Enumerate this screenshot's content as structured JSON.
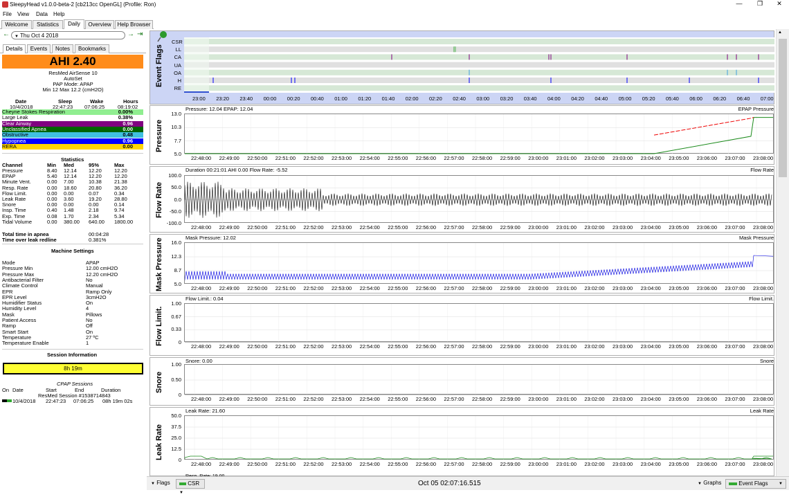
{
  "window": {
    "title": "SleepyHead v1.0.0-beta-2 [cb213cc OpenGL] (Profile: Ron)"
  },
  "menu": [
    "File",
    "View",
    "Data",
    "Help"
  ],
  "tabs": [
    {
      "label": "Welcome"
    },
    {
      "label": "Statistics"
    },
    {
      "label": "Daily",
      "active": true
    },
    {
      "label": "Overview"
    },
    {
      "label": "Help Browser"
    }
  ],
  "nav": {
    "date": "Thu Oct 4 2018"
  },
  "subtabs": [
    "Details",
    "Events",
    "Notes",
    "Bookmarks"
  ],
  "ahi": {
    "label": "AHI 2.40",
    "color": "#ff8c1a"
  },
  "machine": {
    "name": "ResMed AirSense 10",
    "model": "AutoSet",
    "mode": "PAP Mode: APAP",
    "pressure": "Min 12 Max 12.2 (cmH2O)"
  },
  "times": {
    "headers": [
      "Date",
      "Sleep",
      "Wake",
      "Hours"
    ],
    "values": [
      "10/4/2018",
      "22:47:23",
      "07:06:25",
      "08:19:02"
    ]
  },
  "events": [
    {
      "label": "Cheyne Stokes Respiration",
      "value": "0.00%",
      "bg": "#90ee90",
      "fg": "#000"
    },
    {
      "label": "Large Leak",
      "value": "0.38%",
      "bg": "#ffffff",
      "fg": "#000"
    },
    {
      "label": "Clear Airway",
      "value": "0.96",
      "bg": "#800080",
      "fg": "#fff"
    },
    {
      "label": "Unclassified Apnea",
      "value": "0.00",
      "bg": "#006400",
      "fg": "#fff"
    },
    {
      "label": "Obstructive",
      "value": "0.48",
      "bg": "#40c0e0",
      "fg": "#000"
    },
    {
      "label": "Hypopnea",
      "value": "0.96",
      "bg": "#0000ff",
      "fg": "#fff"
    },
    {
      "label": "RERA",
      "value": "0.00",
      "bg": "#ffd700",
      "fg": "#000"
    }
  ],
  "statistics": {
    "title": "Statistics",
    "headers": [
      "Channel",
      "Min",
      "Med",
      "95%",
      "Max"
    ],
    "rows": [
      [
        "Pressure",
        "8.40",
        "12.14",
        "12.20",
        "12.20"
      ],
      [
        "EPAP",
        "5.40",
        "12.14",
        "12.20",
        "12.20"
      ],
      [
        "Minute Vent.",
        "0.00",
        "7.00",
        "10.38",
        "21.38"
      ],
      [
        "Resp. Rate",
        "0.00",
        "18.60",
        "20.80",
        "36.20"
      ],
      [
        "Flow Limit.",
        "0.00",
        "0.00",
        "0.07",
        "0.34"
      ],
      [
        "Leak Rate",
        "0.00",
        "3.60",
        "19.20",
        "28.80"
      ],
      [
        "Snore",
        "0.00",
        "0.00",
        "0.00",
        "0.14"
      ],
      [
        "Insp. Time",
        "0.40",
        "1.48",
        "2.18",
        "9.74"
      ],
      [
        "Exp. Time",
        "0.08",
        "1.70",
        "2.34",
        "5.34"
      ],
      [
        "Tidal Volume",
        "0.00",
        "380.00",
        "640.00",
        "1800.00"
      ]
    ]
  },
  "totals": [
    {
      "label": "Total time in apnea",
      "value": "00:04:28"
    },
    {
      "label": "Time over leak redline",
      "value": "0.381%"
    }
  ],
  "machine_settings": {
    "title": "Machine Settings",
    "rows": [
      [
        "Mode",
        "APAP"
      ],
      [
        "Pressure Min",
        "12.00 cmH2O"
      ],
      [
        "Pressure Max",
        "12.20 cmH2O"
      ],
      [
        "Antibacterial Filter",
        "No"
      ],
      [
        "Climate Control",
        "Manual"
      ],
      [
        "EPR",
        "Ramp Only"
      ],
      [
        "EPR Level",
        "3cmH2O"
      ],
      [
        "Humidifier Status",
        "On"
      ],
      [
        "Humidity Level",
        "4"
      ],
      [
        "Mask",
        "Pillows"
      ],
      [
        "Patient Access",
        "No"
      ],
      [
        "Ramp",
        "Off"
      ],
      [
        "Smart Start",
        "On"
      ],
      [
        "Temperature",
        "27 ºC"
      ],
      [
        "Temperature Enable",
        "1"
      ]
    ]
  },
  "session_info": {
    "title": "Session Information",
    "bar_label": "8h 19m",
    "bar_color": "#ffff33",
    "cpap_title": "CPAP Sessions",
    "headers": [
      "On",
      "Date",
      "Start",
      "End",
      "Duration"
    ],
    "session_name": "ResMed Session #1538714843",
    "row": [
      "10/4/2018",
      "22:47:23",
      "07:06:25",
      "08h 19m 02s"
    ]
  },
  "event_flags": {
    "label": "Event Flags",
    "rows": [
      "CSR",
      "LL",
      "CA",
      "UA",
      "OA",
      "H",
      "RE"
    ],
    "xticks": [
      "23:00",
      "23:20",
      "23:40",
      "00:00",
      "00:20",
      "00:40",
      "01:00",
      "01:20",
      "01:40",
      "02:00",
      "02:20",
      "02:40",
      "03:00",
      "03:20",
      "03:40",
      "04:00",
      "04:20",
      "04:40",
      "05:00",
      "05:20",
      "05:40",
      "06:00",
      "06:20",
      "06:40",
      "07:00"
    ]
  },
  "graph_xticks": [
    "22:48:00",
    "22:49:00",
    "22:50:00",
    "22:51:00",
    "22:52:00",
    "22:53:00",
    "22:54:00",
    "22:55:00",
    "22:56:00",
    "22:57:00",
    "22:58:00",
    "22:59:00",
    "23:00:00",
    "23:01:00",
    "23:02:00",
    "23:03:00",
    "23:04:00",
    "23:05:00",
    "23:06:00",
    "23:07:00",
    "23:08:00"
  ],
  "graphs": [
    {
      "id": "pressure",
      "label": "Pressure",
      "title": "Pressure: 12.04 EPAP: 12.04",
      "legend": "EPAP  Pressure",
      "yticks": [
        "13.0",
        "10.3",
        "7.7",
        "5.0"
      ]
    },
    {
      "id": "flow",
      "label": "Flow Rate",
      "title": "Duration 00:21:01 AHI 0.00 Flow Rate: -5.52",
      "legend": "Flow Rate",
      "yticks": [
        "100.0",
        "50.0",
        "0.0",
        "-50.0",
        "-100.0"
      ]
    },
    {
      "id": "mask",
      "label": "Mask Pressure",
      "title": "Mask Pressure: 12.02",
      "legend": "Mask Pressure",
      "yticks": [
        "16.0",
        "12.3",
        "8.7",
        "5.0"
      ]
    },
    {
      "id": "flowlim",
      "label": "Flow Limit.",
      "title": "Flow Limit.: 0.04",
      "legend": "Flow Limit.",
      "yticks": [
        "1.00",
        "0.67",
        "0.33",
        "0"
      ]
    },
    {
      "id": "snore",
      "label": "Snore",
      "title": "Snore: 0.00",
      "legend": "Snore",
      "yticks": [
        "1.00",
        "0.50",
        "0"
      ]
    },
    {
      "id": "leak",
      "label": "Leak Rate",
      "title": "Leak Rate: 21.60",
      "legend": "Leak Rate",
      "yticks": [
        "50.0",
        "37.5",
        "25.0",
        "12.5",
        "0"
      ]
    }
  ],
  "resp_rate_title": "Resp. Rate: 19.00",
  "bottom": {
    "flags_label": "Flags",
    "csr_label": "CSR",
    "timestamp": "Oct 05 02:07:16.515",
    "graphs_label": "Graphs",
    "event_flags_label": "Event Flags"
  }
}
